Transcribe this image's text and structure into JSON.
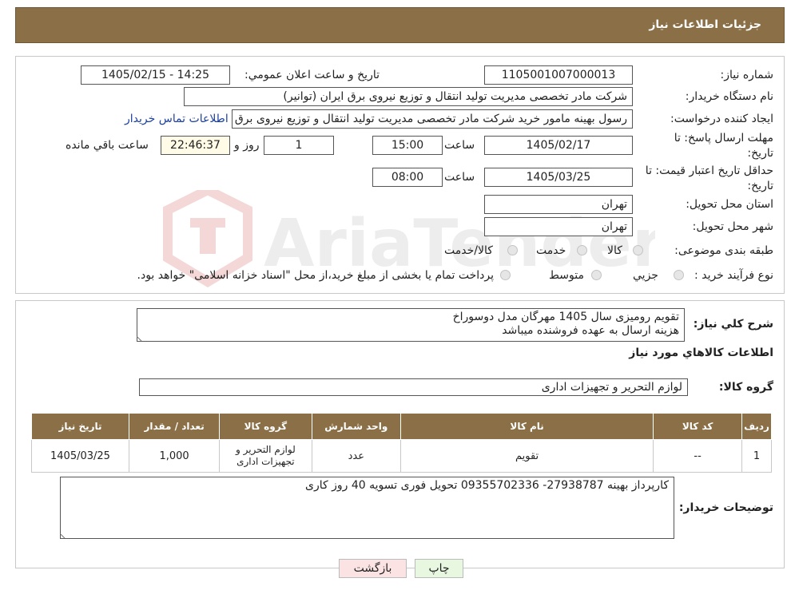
{
  "header": {
    "title": "جزئیات اطلاعات نیاز"
  },
  "form": {
    "need_number_label": "شماره نیاز:",
    "need_number": "1105001007000013",
    "announce_label": "تاریخ و ساعت اعلان عمومي:",
    "announce_value": "1405/02/15 - 14:25",
    "buyer_org_label": "نام دستگاه خريدار:",
    "buyer_org": "شرکت مادر تخصصی مدیریت تولید  انتقال و توزیع نیروی برق ایران (توانیر)",
    "creator_label": "ايجاد کننده درخواست:",
    "creator": "رسول بهینه مامور خرید شرکت مادر تخصصی مدیریت تولید  انتقال و توزیع نیروی برق",
    "contact_link": "اطلاعات تماس خريدار",
    "deadline_label_1": "مهلت ارسال پاسخ: تا",
    "deadline_label_2": "تاريخ:",
    "deadline_date": "1405/02/17",
    "time_label": "ساعت",
    "deadline_time": "15:00",
    "days_value": "1",
    "days_label": "روز و",
    "remaining_time": "22:46:37",
    "remaining_label": "ساعت باقي مانده",
    "validity_label_1": "حداقل تاريخ اعتبار قيمت: تا",
    "validity_label_2": "تاريخ:",
    "validity_date": "1405/03/25",
    "validity_time": "08:00",
    "province_label": "استان محل تحويل:",
    "province": "تهران",
    "city_label": "شهر محل تحويل:",
    "city": "تهران",
    "category_label": "طبقه بندی موضوعی:",
    "category_options": [
      "کالا",
      "خدمت",
      "کالا/خدمت"
    ],
    "process_label": "نوع فرآيند خريد :",
    "process_options": [
      "جزيي",
      "متوسط"
    ],
    "process_note": "پرداخت تمام یا بخشی از مبلغ خرید،از محل \"اسناد خزانه اسلامی\" خواهد بود."
  },
  "description": {
    "label": "شرح كلي نياز:",
    "line1": "تقویم رومیزی سال 1405 مهرگان مدل دوسوراخ",
    "line2": "هزینه ارسال به عهده فروشنده میباشد"
  },
  "goods_section": {
    "title": "اطلاعات كالاهاي مورد نياز",
    "group_label": "گروه كالا:",
    "group_value": "لوازم التحرير و تجهيزات اداری"
  },
  "table": {
    "headers": [
      "رديف",
      "کد کالا",
      "نام کالا",
      "واحد شمارش",
      "گروه کالا",
      "تعداد / مقدار",
      "تاريخ نياز"
    ],
    "rows": [
      [
        "1",
        "--",
        "تقويم",
        "عدد",
        "لوازم التحرير و تجهيزات اداری",
        "1,000",
        "1405/03/25"
      ]
    ]
  },
  "buyer_notes": {
    "label": "توضيحات خريدار:",
    "text": "کارپرداز بهینه 27938787- 09355702336  تحویل فوری  تسویه 40 روز کاری"
  },
  "buttons": {
    "print": "چاپ",
    "back": "بازگشت"
  },
  "watermark": {
    "text": "AriaTender.neT"
  },
  "colors": {
    "header_bg": "#8b7047",
    "link": "#1a3fa0",
    "print_btn": "#e8f7e0",
    "back_btn": "#fbe3e3"
  }
}
